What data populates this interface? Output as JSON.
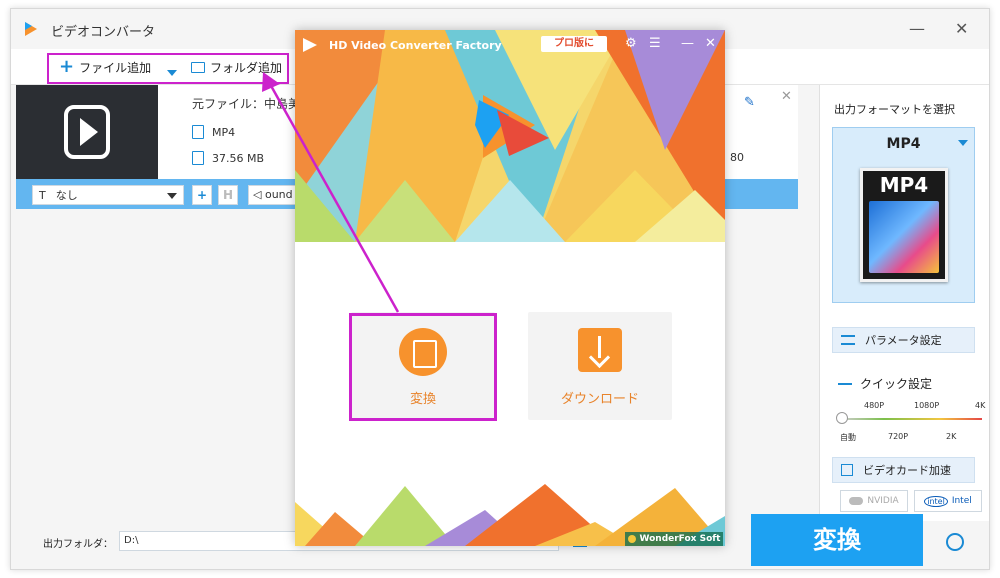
{
  "window": {
    "title": "ビデオコンバータ",
    "minimize": "—",
    "close": "✕"
  },
  "toolbar": {
    "add_file": "ファイル追加",
    "add_folder": "フォルダ追加"
  },
  "file_card": {
    "source_label": "元ファイル：中島美",
    "format": "MP4",
    "size": "37.56 MB",
    "right_value": "80"
  },
  "edit_band": {
    "subtitle_value": "なし",
    "sound_value": "ound"
  },
  "output_panel": {
    "title": "出力フォーマットを選択",
    "format": "MP4",
    "format_picture_label": "MP4",
    "param_button": "パラメータ設定",
    "quick_label": "クイック設定",
    "quality_top": [
      "480P",
      "1080P",
      "4K"
    ],
    "quality_bottom": [
      "自動",
      "720P",
      "2K"
    ],
    "gpu_button": "ビデオカード加速",
    "vendor_nvidia": "NVIDIA",
    "vendor_intel": "Intel"
  },
  "bottom": {
    "output_folder_label": "出力フォルダ：",
    "output_folder_value": "D:\\",
    "convert_label": "変換"
  },
  "dialog": {
    "title": "HD Video Converter Factory",
    "pro_button": "プロ版に",
    "minimize": "—",
    "close": "✕",
    "convert_label": "変換",
    "download_label": "ダウンロード",
    "brand": "WonderFox Soft"
  },
  "colors": {
    "accent": "#1da1f2",
    "highlight": "#cc22cc",
    "orange": "#f7922d"
  }
}
